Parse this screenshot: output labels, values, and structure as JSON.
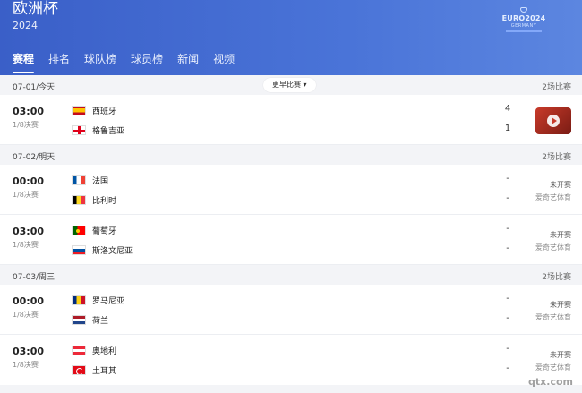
{
  "header": {
    "title": "欧洲杯",
    "year": "2024",
    "logo_text": "EURO2024",
    "logo_sub": "GERMANY"
  },
  "tabs": [
    {
      "label": "赛程",
      "active": true
    },
    {
      "label": "排名"
    },
    {
      "label": "球队榜"
    },
    {
      "label": "球员榜"
    },
    {
      "label": "新闻"
    },
    {
      "label": "视频"
    }
  ],
  "sections": [
    {
      "date": "07-01/今天",
      "count": "2场比赛",
      "more_label": "更早比赛",
      "matches": [
        {
          "time": "03:00",
          "round": "1/8决赛",
          "home": {
            "name": "西班牙",
            "flag": "es"
          },
          "away": {
            "name": "格鲁吉亚",
            "flag": "ge"
          },
          "home_score": "4",
          "away_score": "1",
          "has_video": true
        }
      ]
    },
    {
      "date": "07-02/明天",
      "count": "2场比赛",
      "matches": [
        {
          "time": "00:00",
          "round": "1/8决赛",
          "home": {
            "name": "法国",
            "flag": "fr"
          },
          "away": {
            "name": "比利时",
            "flag": "be"
          },
          "home_score": "-",
          "away_score": "-",
          "status": "未开赛",
          "channel": "爱奇艺体育"
        },
        {
          "time": "03:00",
          "round": "1/8决赛",
          "home": {
            "name": "葡萄牙",
            "flag": "pt"
          },
          "away": {
            "name": "斯洛文尼亚",
            "flag": "si"
          },
          "home_score": "-",
          "away_score": "-",
          "status": "未开赛",
          "channel": "爱奇艺体育"
        }
      ]
    },
    {
      "date": "07-03/周三",
      "count": "2场比赛",
      "matches": [
        {
          "time": "00:00",
          "round": "1/8决赛",
          "home": {
            "name": "罗马尼亚",
            "flag": "ro"
          },
          "away": {
            "name": "荷兰",
            "flag": "nl"
          },
          "home_score": "-",
          "away_score": "-",
          "status": "未开赛",
          "channel": "爱奇艺体育"
        },
        {
          "time": "03:00",
          "round": "1/8决赛",
          "home": {
            "name": "奥地利",
            "flag": "at"
          },
          "away": {
            "name": "土耳其",
            "flag": "tr"
          },
          "home_score": "-",
          "away_score": "-",
          "status": "未开赛",
          "channel": "爱奇艺体育"
        }
      ]
    }
  ],
  "watermark": "qtx.com",
  "colors": {
    "header_blue": "#3a5fc8",
    "accent_white": "#ffffff"
  }
}
